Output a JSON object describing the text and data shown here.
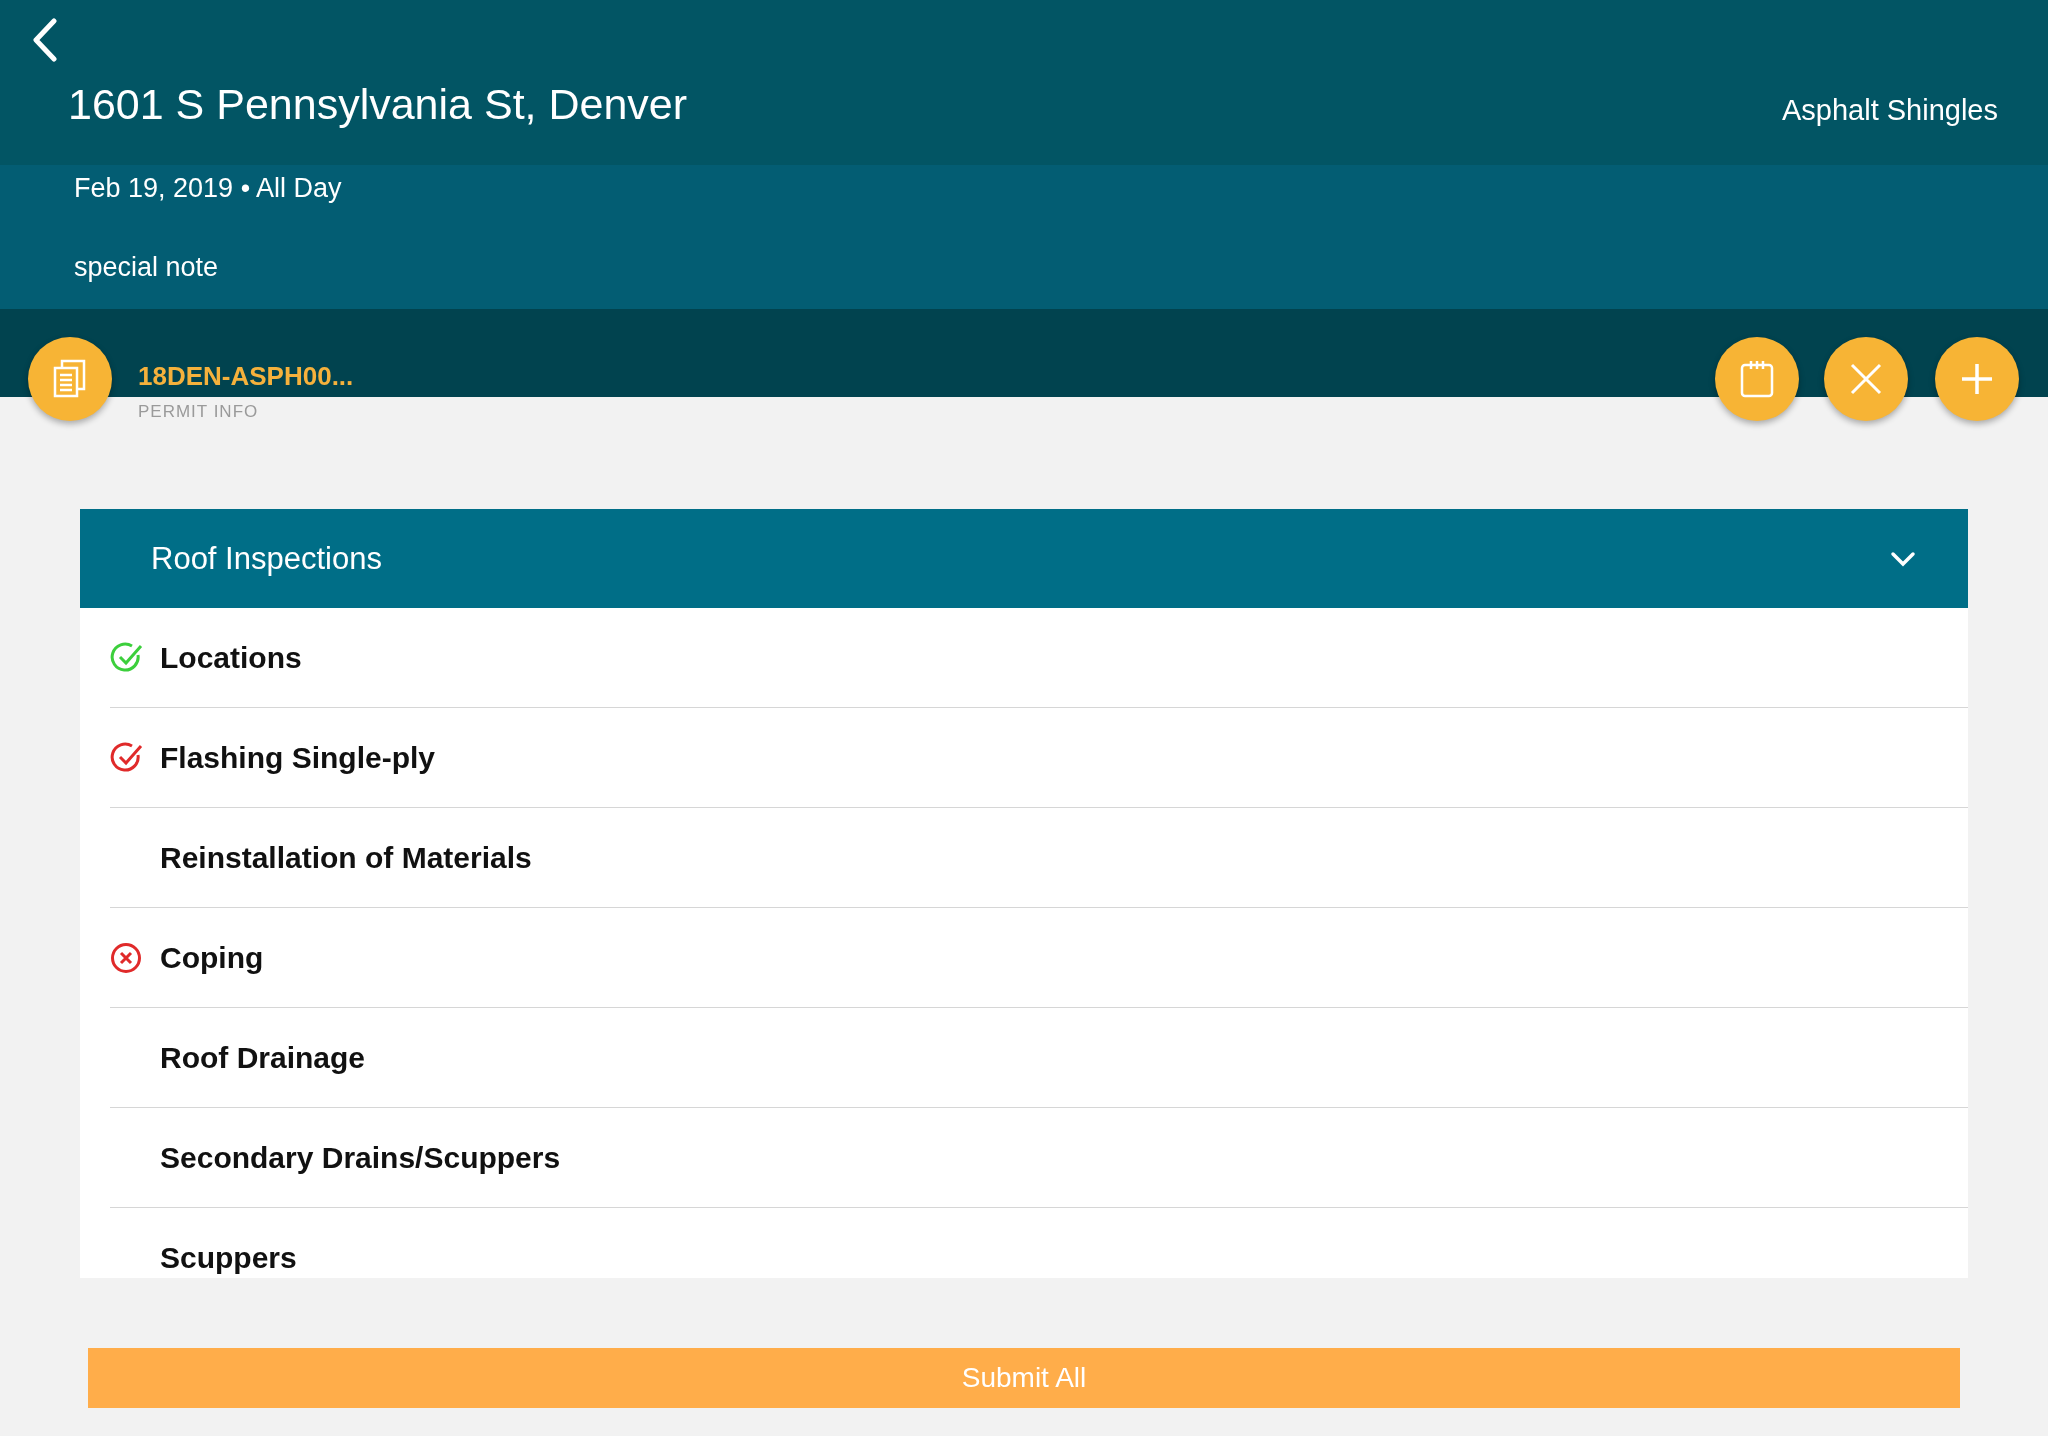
{
  "header": {
    "title": "1601 S Pennsylvania St, Denver",
    "roof_type": "Asphalt Shingles",
    "date": "Feb 19, 2019 • All Day",
    "note": "special note"
  },
  "permit": {
    "number": "18DEN-ASPH00...",
    "label": "PERMIT INFO"
  },
  "section": {
    "title": "Roof Inspections",
    "expanded": true,
    "items": [
      {
        "label": "Locations",
        "kind": "passed"
      },
      {
        "label": "Flashing Single-ply",
        "kind": "marked"
      },
      {
        "label": "Reinstallation of Materials",
        "kind": "none"
      },
      {
        "label": "Coping",
        "kind": "failed"
      },
      {
        "label": "Roof Drainage",
        "kind": "none"
      },
      {
        "label": "Secondary Drains/Scuppers",
        "kind": "none"
      },
      {
        "label": "Scuppers",
        "kind": "none"
      }
    ]
  },
  "submit": {
    "label": "Submit All"
  }
}
